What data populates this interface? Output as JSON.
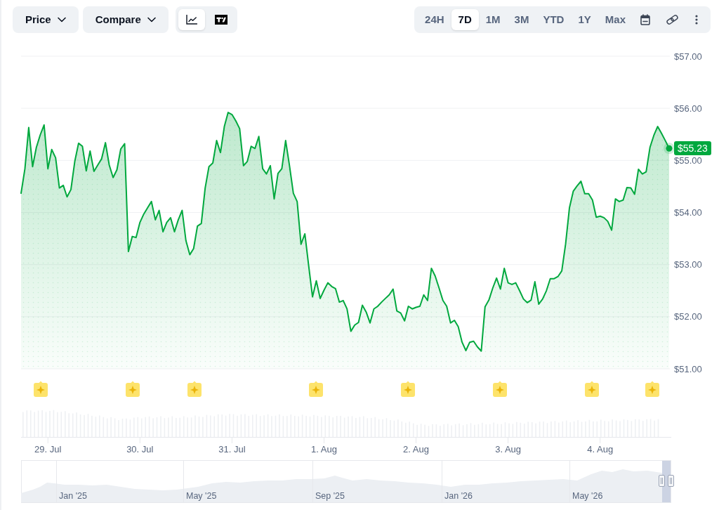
{
  "toolbar": {
    "dropdowns": [
      {
        "label": "Price"
      },
      {
        "label": "Compare"
      }
    ],
    "chart_types": [
      {
        "kind": "line",
        "selected": true
      },
      {
        "kind": "logo",
        "selected": false
      }
    ],
    "ranges": [
      {
        "label": "24H",
        "selected": false
      },
      {
        "label": "7D",
        "selected": true
      },
      {
        "label": "1M",
        "selected": false
      },
      {
        "label": "3M",
        "selected": false
      },
      {
        "label": "YTD",
        "selected": false
      },
      {
        "label": "1Y",
        "selected": false
      },
      {
        "label": "Max",
        "selected": false
      }
    ]
  },
  "chart": {
    "chart_data": {
      "type": "area",
      "grid": true,
      "categories": [
        null,
        null,
        null,
        null,
        null,
        null,
        null,
        "29. Jul",
        null,
        null,
        null,
        null,
        null,
        null,
        null,
        null,
        null,
        null,
        null,
        null,
        null,
        null,
        null,
        null,
        null,
        null,
        null,
        null,
        null,
        null,
        null,
        "30. Jul",
        null,
        null,
        null,
        null,
        null,
        null,
        null,
        null,
        null,
        null,
        null,
        null,
        null,
        null,
        null,
        null,
        null,
        null,
        null,
        null,
        null,
        null,
        null,
        "31. Jul",
        null,
        null,
        null,
        null,
        null,
        null,
        null,
        null,
        null,
        null,
        null,
        null,
        null,
        null,
        null,
        null,
        null,
        null,
        null,
        null,
        null,
        null,
        null,
        "1. Aug",
        null,
        null,
        null,
        null,
        null,
        null,
        null,
        null,
        null,
        null,
        null,
        null,
        null,
        null,
        null,
        null,
        null,
        null,
        null,
        null,
        null,
        null,
        null,
        "2. Aug",
        null,
        null,
        null,
        null,
        null,
        null,
        null,
        null,
        null,
        null,
        null,
        null,
        null,
        null,
        null,
        null,
        null,
        null,
        null,
        null,
        null,
        null,
        null,
        "3. Aug",
        null,
        null,
        null,
        null,
        null,
        null,
        null,
        null,
        null,
        null,
        null,
        null,
        null,
        null,
        null,
        null,
        null,
        null,
        null,
        null,
        null,
        null,
        null,
        "4. Aug",
        null,
        null,
        null,
        null,
        null,
        null,
        null,
        null,
        null,
        null,
        null,
        null,
        null,
        null,
        null,
        null,
        null,
        null
      ],
      "series": [
        {
          "color": "#00a83e",
          "values": [
            54.37,
            54.84,
            55.63,
            54.88,
            55.25,
            55.49,
            55.68,
            54.84,
            55.21,
            55.05,
            54.47,
            54.52,
            54.3,
            54.44,
            54.98,
            55.33,
            55.27,
            54.8,
            55.18,
            54.79,
            54.91,
            55.03,
            55.34,
            54.91,
            54.67,
            54.82,
            55.22,
            55.32,
            53.25,
            53.54,
            53.52,
            53.81,
            53.97,
            54.09,
            54.21,
            53.86,
            54.04,
            53.63,
            53.81,
            53.9,
            53.63,
            53.86,
            54.04,
            53.46,
            53.19,
            53.31,
            53.74,
            53.79,
            54.47,
            54.88,
            54.95,
            55.38,
            55.15,
            55.65,
            55.92,
            55.88,
            55.76,
            55.61,
            54.9,
            54.98,
            55.27,
            55.23,
            55.46,
            54.84,
            54.74,
            54.9,
            54.26,
            54.75,
            54.84,
            55.38,
            54.9,
            54.37,
            54.21,
            53.39,
            53.59,
            52.98,
            52.38,
            52.69,
            52.35,
            52.51,
            52.65,
            52.58,
            52.54,
            52.28,
            52.31,
            52.15,
            51.72,
            51.84,
            51.89,
            52.22,
            52.09,
            51.88,
            52.15,
            52.2,
            52.28,
            52.35,
            52.42,
            52.53,
            52.11,
            52.07,
            51.92,
            52.2,
            52.15,
            52.18,
            52.2,
            52.42,
            52.31,
            52.93,
            52.78,
            52.55,
            52.31,
            52.2,
            51.88,
            51.93,
            51.81,
            51.51,
            51.35,
            51.51,
            51.53,
            51.42,
            51.34,
            52.19,
            52.32,
            52.55,
            52.74,
            52.53,
            52.93,
            52.65,
            52.62,
            52.65,
            52.5,
            52.34,
            52.27,
            52.32,
            52.67,
            52.24,
            52.34,
            52.5,
            52.73,
            52.73,
            52.77,
            52.88,
            53.39,
            54.09,
            54.41,
            54.51,
            54.6,
            54.36,
            54.36,
            54.24,
            53.91,
            53.93,
            53.9,
            53.83,
            53.66,
            54.26,
            54.21,
            54.24,
            54.48,
            54.47,
            54.35,
            54.83,
            54.74,
            54.78,
            55.25,
            55.48,
            55.65,
            55.52,
            55.38,
            55.23
          ]
        }
      ],
      "ylim": [
        51,
        57
      ],
      "yticks": [
        {
          "value": 57,
          "label": "$57.00"
        },
        {
          "value": 56,
          "label": "$56.00"
        },
        {
          "value": 55,
          "label": "$55.00"
        },
        {
          "value": 54,
          "label": "$54.00"
        },
        {
          "value": 53,
          "label": "$53.00"
        },
        {
          "value": 52,
          "label": "$52.00"
        },
        {
          "value": 51,
          "label": "$51.00"
        }
      ],
      "annotations": [
        "$55.23"
      ]
    }
  },
  "navigator": {
    "labels": [
      "Jan '25",
      "May '25",
      "Sep '25",
      "Jan '26",
      "May '26"
    ]
  }
}
